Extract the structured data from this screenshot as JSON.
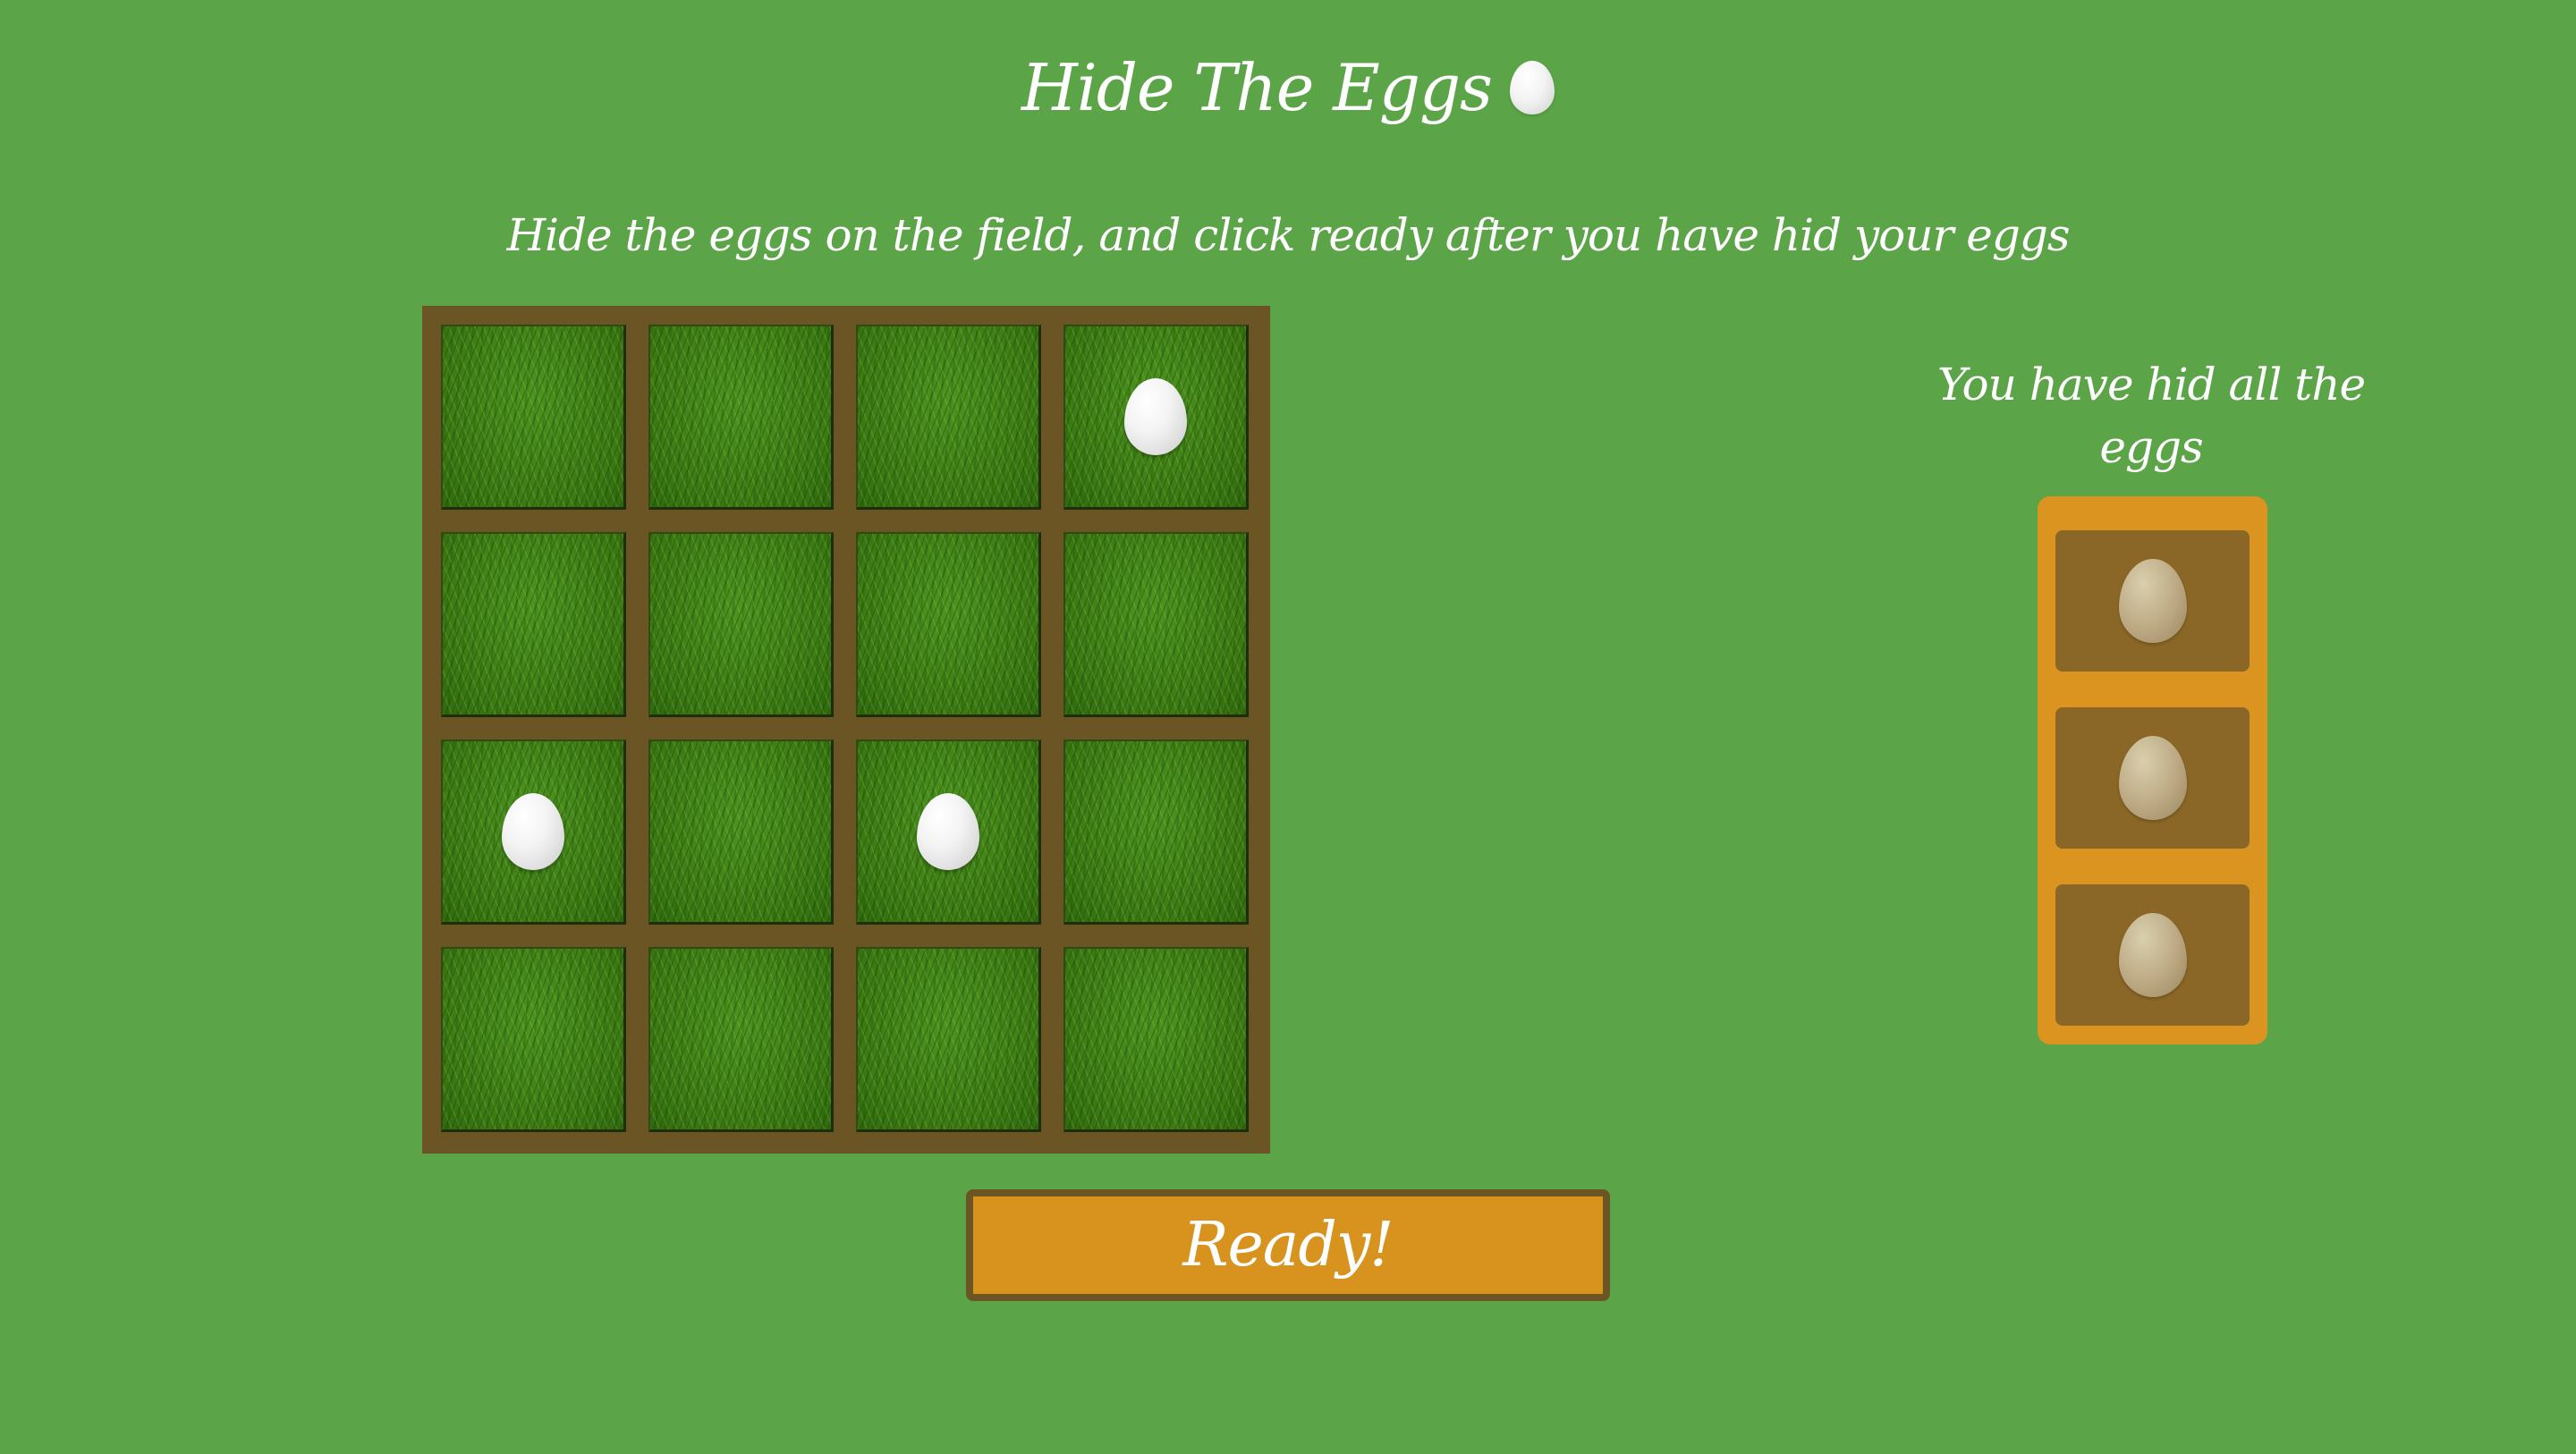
{
  "header": {
    "title": "Hide The Eggs",
    "title_icon": "egg-icon"
  },
  "instructions": "Hide the eggs on the field, and click ready after you have hid your eggs",
  "field": {
    "rows": 4,
    "columns": 4,
    "cells": [
      {
        "has_egg": false
      },
      {
        "has_egg": false
      },
      {
        "has_egg": false
      },
      {
        "has_egg": true
      },
      {
        "has_egg": false
      },
      {
        "has_egg": false
      },
      {
        "has_egg": false
      },
      {
        "has_egg": false
      },
      {
        "has_egg": true
      },
      {
        "has_egg": false
      },
      {
        "has_egg": true
      },
      {
        "has_egg": false
      },
      {
        "has_egg": false
      },
      {
        "has_egg": false
      },
      {
        "has_egg": false
      },
      {
        "has_egg": false
      }
    ]
  },
  "status": "You have hid all the eggs",
  "egg_box": {
    "slots": [
      {
        "icon": "egg-icon",
        "state": "used"
      },
      {
        "icon": "egg-icon",
        "state": "used"
      },
      {
        "icon": "egg-icon",
        "state": "used"
      }
    ]
  },
  "ready_button": {
    "label": "Ready!"
  },
  "colors": {
    "background": "#5ba447",
    "field_frame": "#6b5524",
    "egg_box": "#dc9420",
    "egg_slot": "#8a6726",
    "button": "#d8931f"
  }
}
